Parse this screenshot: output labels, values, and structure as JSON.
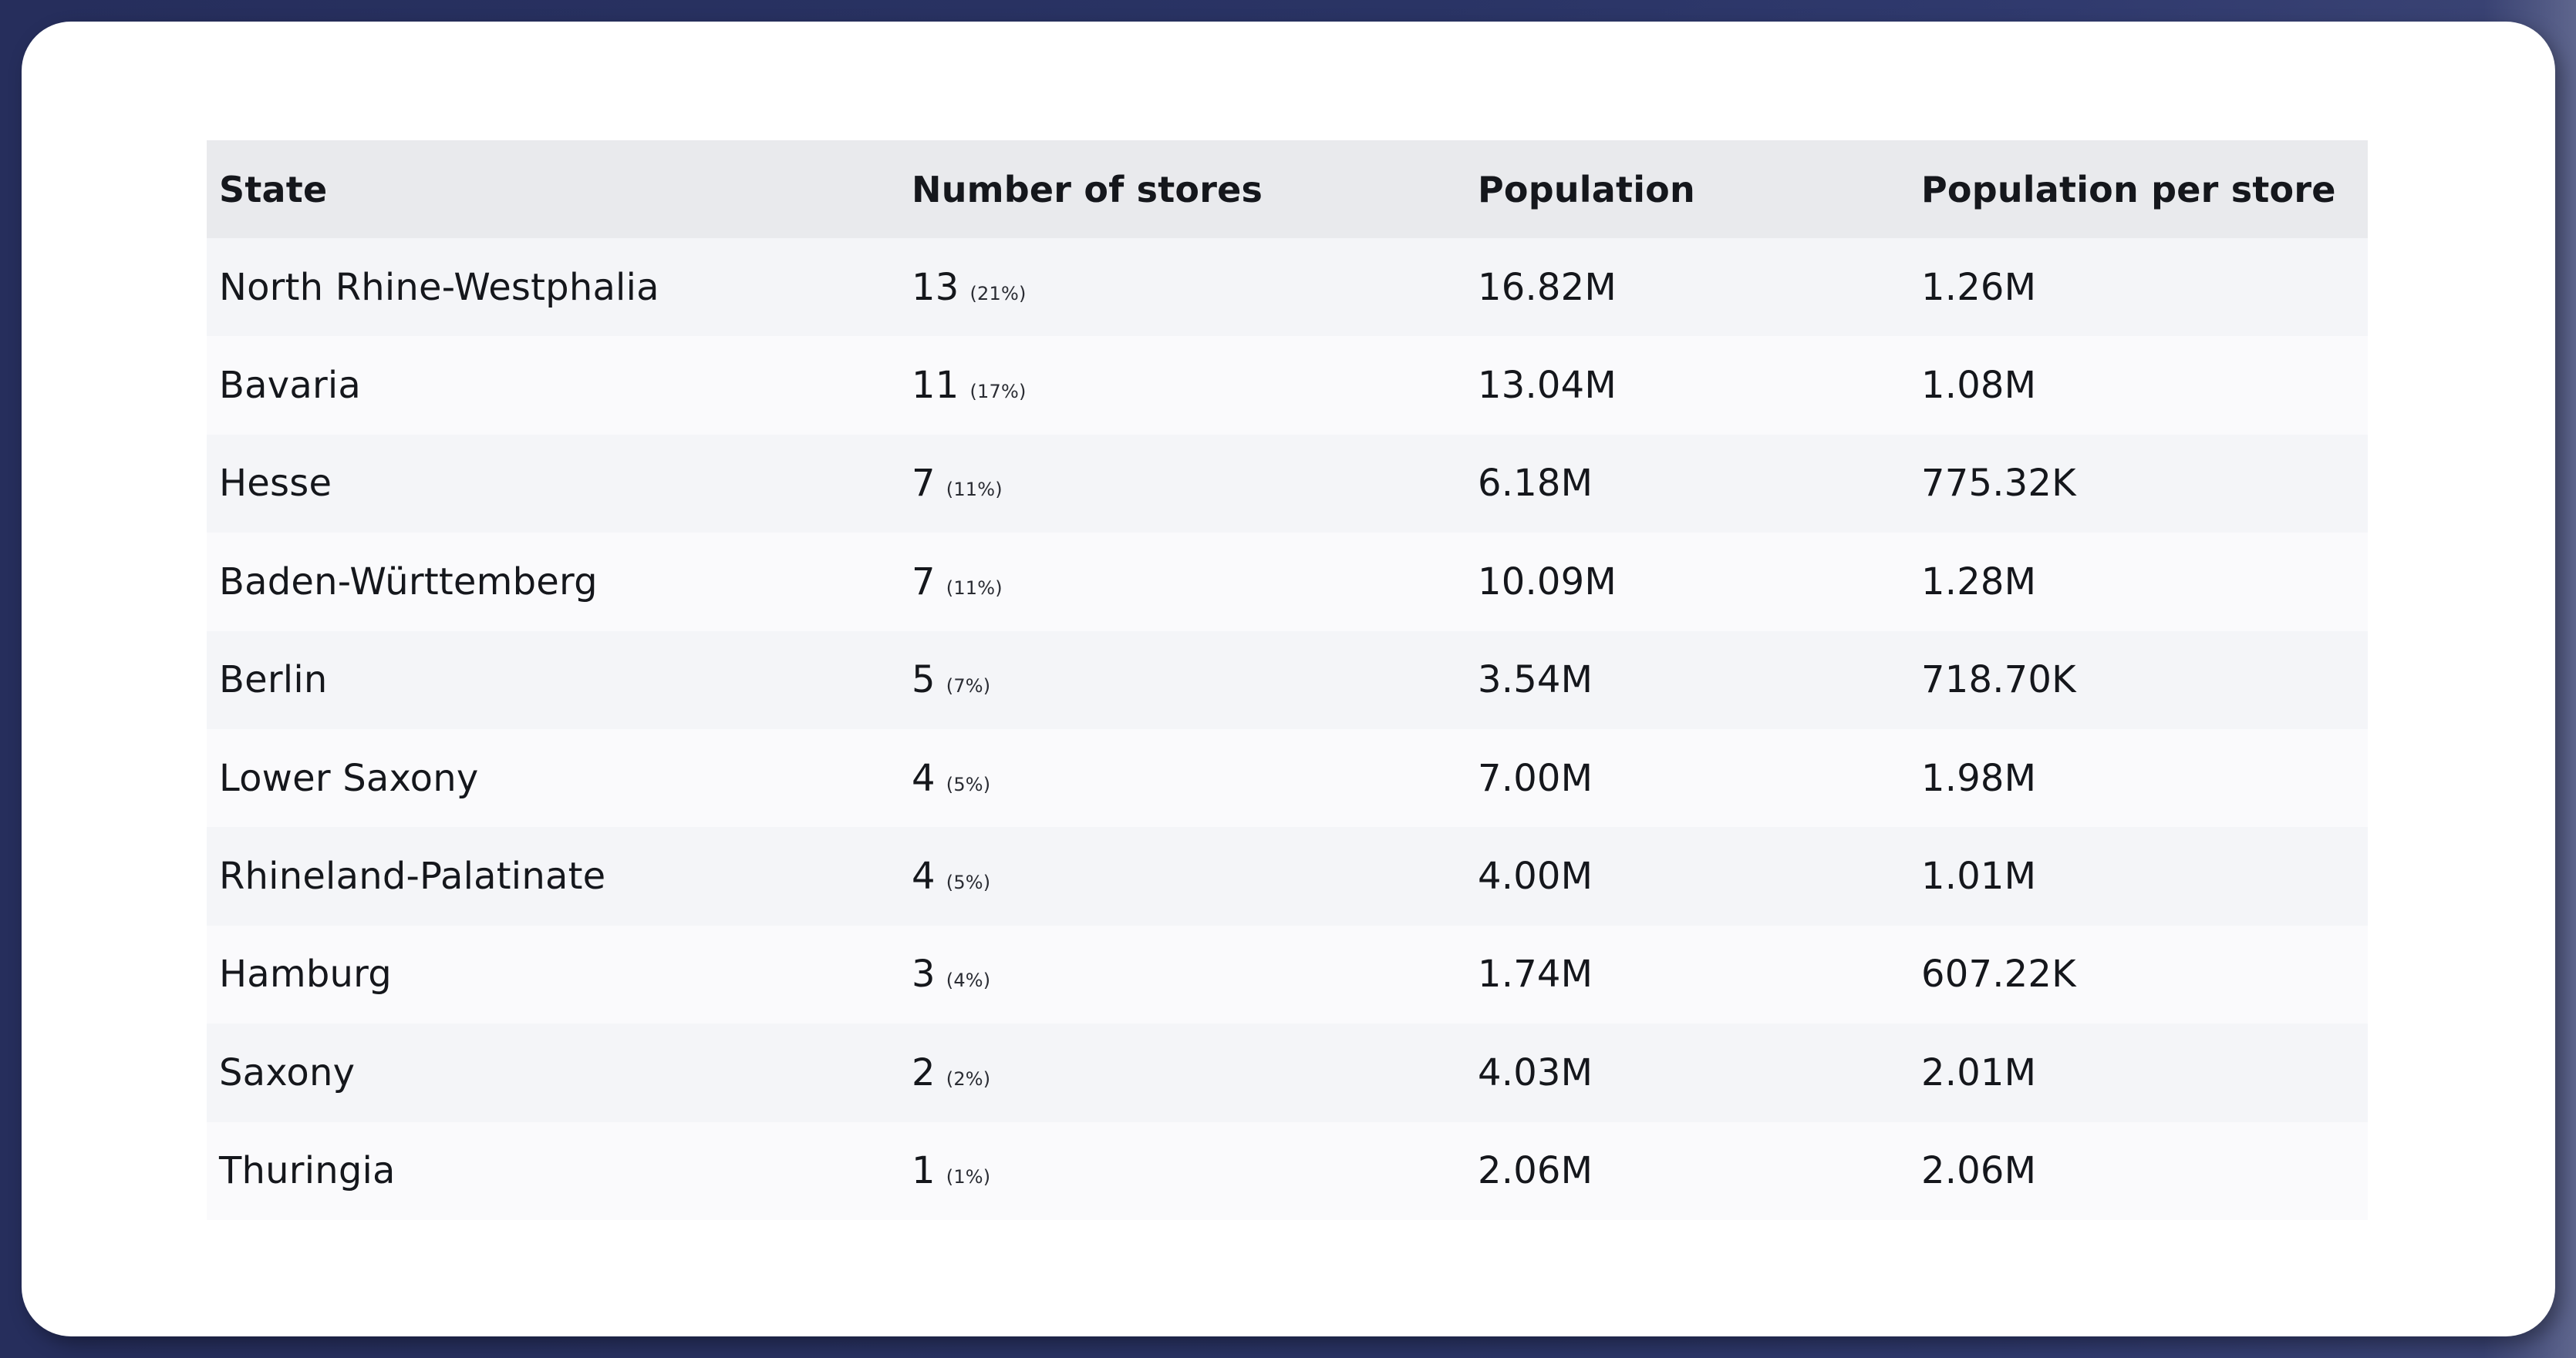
{
  "table": {
    "headers": [
      "State",
      "Number of stores",
      "Population",
      "Population per store"
    ],
    "rows": [
      {
        "state": "North Rhine-Westphalia",
        "stores": "13",
        "stores_pct": "(21%)",
        "population": "16.82M",
        "per_store": "1.26M"
      },
      {
        "state": "Bavaria",
        "stores": "11",
        "stores_pct": "(17%)",
        "population": "13.04M",
        "per_store": "1.08M"
      },
      {
        "state": "Hesse",
        "stores": "7",
        "stores_pct": "(11%)",
        "population": "6.18M",
        "per_store": "775.32K"
      },
      {
        "state": "Baden-Württemberg",
        "stores": "7",
        "stores_pct": "(11%)",
        "population": "10.09M",
        "per_store": "1.28M"
      },
      {
        "state": "Berlin",
        "stores": "5",
        "stores_pct": "(7%)",
        "population": "3.54M",
        "per_store": "718.70K"
      },
      {
        "state": "Lower Saxony",
        "stores": "4",
        "stores_pct": "(5%)",
        "population": "7.00M",
        "per_store": "1.98M"
      },
      {
        "state": "Rhineland-Palatinate",
        "stores": "4",
        "stores_pct": "(5%)",
        "population": "4.00M",
        "per_store": "1.01M"
      },
      {
        "state": "Hamburg",
        "stores": "3",
        "stores_pct": "(4%)",
        "population": "1.74M",
        "per_store": "607.22K"
      },
      {
        "state": "Saxony",
        "stores": "2",
        "stores_pct": "(2%)",
        "population": "4.03M",
        "per_store": "2.01M"
      },
      {
        "state": "Thuringia",
        "stores": "1",
        "stores_pct": "(1%)",
        "population": "2.06M",
        "per_store": "2.06M"
      }
    ]
  },
  "colors": {
    "background": "#2a3465",
    "card": "#ffffff",
    "header_row": "#e9eaed",
    "row_alt_a": "#f4f5f8",
    "row_alt_b": "#fafafc",
    "text": "#15171c"
  }
}
